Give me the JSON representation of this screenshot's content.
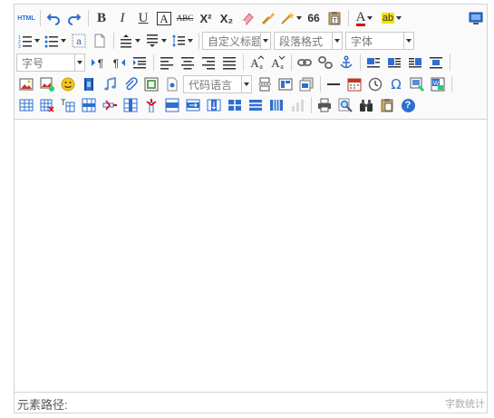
{
  "toolbar": {
    "html_label": "HTML",
    "bold": "B",
    "italic": "I",
    "underline": "U",
    "font_border": "A",
    "strikethrough": "ABC",
    "superscript": "X²",
    "subscript": "X₂",
    "blockquote": "66",
    "font_color": "A",
    "highlight": "ab",
    "customstyle_placeholder": "自定义标题",
    "paragraph_placeholder": "段落格式",
    "fontfamily_placeholder": "字体",
    "fontsize_placeholder": "字号",
    "codelang_placeholder": "代码语言",
    "omega": "Ω",
    "help": "?"
  },
  "colors": {
    "accent": "#2c6fd1",
    "toolbar_bg": "#fafafa",
    "border": "#d4d4d4"
  },
  "statusbar": {
    "path_label": "元素路径:",
    "wordcount_label": "字数统计"
  }
}
